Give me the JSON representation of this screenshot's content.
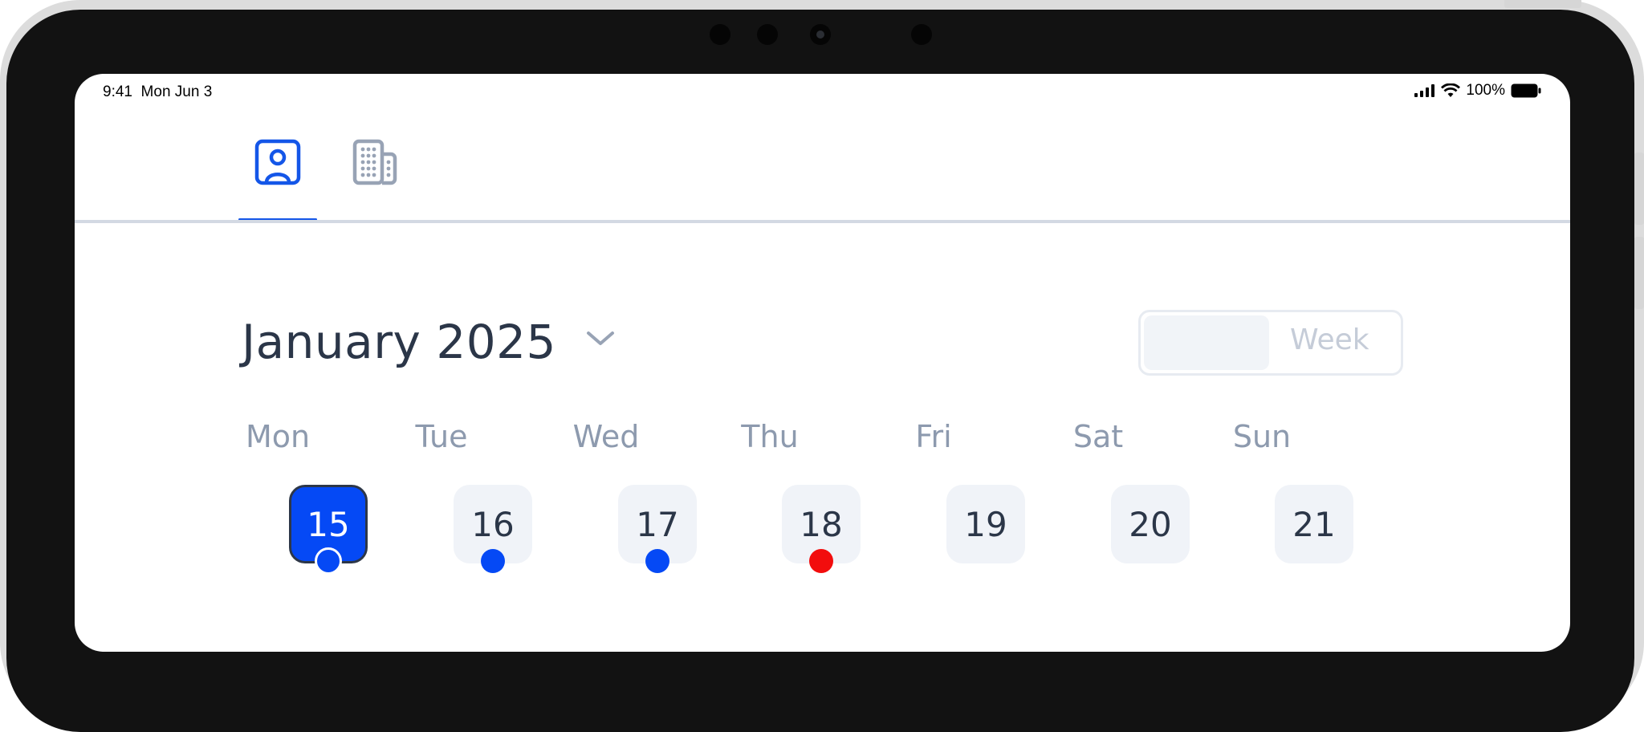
{
  "status_bar": {
    "time": "9:41",
    "date": "Mon Jun 3",
    "battery": "100%"
  },
  "tabs": [
    {
      "icon": "person-card-icon",
      "active": true
    },
    {
      "icon": "building-icon",
      "active": false
    }
  ],
  "calendar": {
    "month_label": "January 2025",
    "view_toggle": {
      "option_2": "Week"
    },
    "weekdays": [
      "Mon",
      "Tue",
      "Wed",
      "Thu",
      "Fri",
      "Sat",
      "Sun"
    ],
    "dates": [
      "15",
      "16",
      "17",
      "18",
      "19",
      "20",
      "21"
    ],
    "selected_date": "15",
    "event_dots": [
      {
        "date": "15",
        "color": "#0549f5"
      },
      {
        "date": "16",
        "color": "#0549f5"
      },
      {
        "date": "17",
        "color": "#0549f5"
      },
      {
        "date": "18",
        "color": "#f20d0d"
      }
    ]
  },
  "colors": {
    "accent": "#1456e8",
    "selected_date_bg": "#0549f5",
    "text_dark": "#2b3648",
    "text_muted": "#8d9aae",
    "dot_alert": "#f20d0d"
  }
}
